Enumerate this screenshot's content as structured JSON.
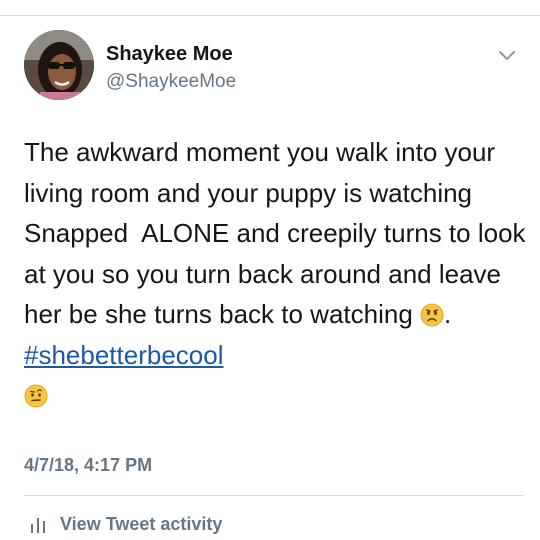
{
  "tweet": {
    "author_name": "Shaykee Moe",
    "author_handle": "@ShaykeeMoe",
    "text_before_emoji": "The awkward moment you walk into your living room and your puppy is watching Snapped  ALONE and creepily turns to look at you so you turn back around and leave her be she turns back to watching ",
    "text_after_emoji": ". ",
    "hashtag": "#shebetterbecool",
    "emoji_1": "worried-face-emoji",
    "emoji_2": "face-with-raised-eyebrow-emoji",
    "timestamp": "4/7/18, 4:17 PM",
    "activity_label": "View Tweet activity"
  },
  "icons": {
    "menu": "chevron-down-icon",
    "activity": "bar-chart-icon"
  },
  "colors": {
    "text": "#14171a",
    "secondary": "#657786",
    "link": "#1b5aa8",
    "divider": "#d6dbe0",
    "emoji": "#f6c642"
  }
}
